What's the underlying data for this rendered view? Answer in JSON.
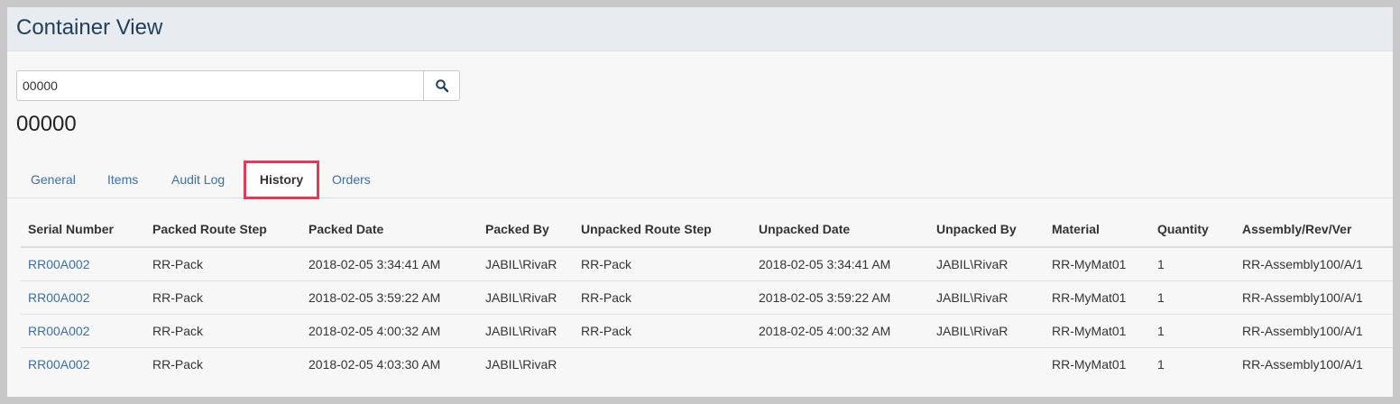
{
  "header": {
    "title": "Container View"
  },
  "search": {
    "value": "00000",
    "icon": "search-icon"
  },
  "container": {
    "id": "00000"
  },
  "tabs": [
    {
      "label": "General",
      "active": false
    },
    {
      "label": "Items",
      "active": false
    },
    {
      "label": "Audit Log",
      "active": false
    },
    {
      "label": "History",
      "active": true
    },
    {
      "label": "Orders",
      "active": false
    }
  ],
  "history": {
    "columns": [
      "Serial Number",
      "Packed Route Step",
      "Packed Date",
      "Packed By",
      "Unpacked Route Step",
      "Unpacked Date",
      "Unpacked By",
      "Material",
      "Quantity",
      "Assembly/Rev/Ver"
    ],
    "rows": [
      [
        "RR00A002",
        "RR-Pack",
        "2018-02-05 3:34:41 AM",
        "JABIL\\RivaR",
        "RR-Pack",
        "2018-02-05 3:34:41 AM",
        "JABIL\\RivaR",
        "RR-MyMat01",
        "1",
        "RR-Assembly100/A/1"
      ],
      [
        "RR00A002",
        "RR-Pack",
        "2018-02-05 3:59:22 AM",
        "JABIL\\RivaR",
        "RR-Pack",
        "2018-02-05 3:59:22 AM",
        "JABIL\\RivaR",
        "RR-MyMat01",
        "1",
        "RR-Assembly100/A/1"
      ],
      [
        "RR00A002",
        "RR-Pack",
        "2018-02-05 4:00:32 AM",
        "JABIL\\RivaR",
        "RR-Pack",
        "2018-02-05 4:00:32 AM",
        "JABIL\\RivaR",
        "RR-MyMat01",
        "1",
        "RR-Assembly100/A/1"
      ],
      [
        "RR00A002",
        "RR-Pack",
        "2018-02-05 4:03:30 AM",
        "JABIL\\RivaR",
        "",
        "",
        "",
        "RR-MyMat01",
        "1",
        "RR-Assembly100/A/1"
      ]
    ]
  },
  "colors": {
    "link": "#3b6ea5",
    "highlight": "#e03c5a",
    "header_bg": "#e8ebef",
    "title": "#1f3f5c"
  }
}
